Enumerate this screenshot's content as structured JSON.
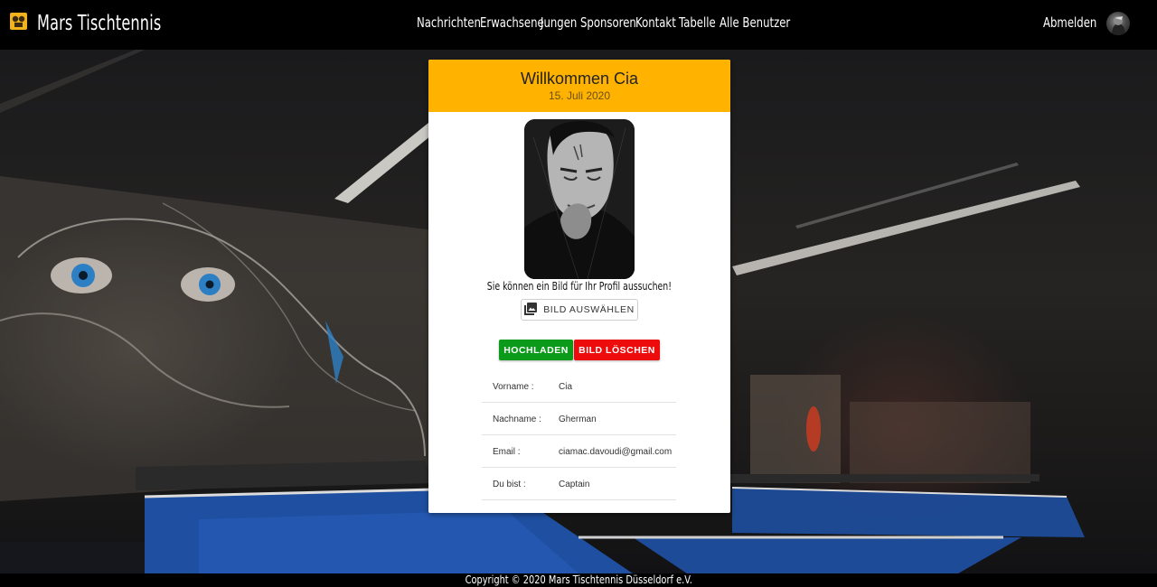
{
  "brand": {
    "title": "Mars Tischtennis",
    "logo_icon": "ping-pong-logo-icon"
  },
  "nav": {
    "items": [
      "Nachrichten",
      "Erwachsene",
      "Jungen",
      "Sponsoren",
      "Kontakt",
      "Tabelle",
      "Alle Benutzer"
    ],
    "logout": "Abmelden",
    "avatar_icon": "user-avatar"
  },
  "card": {
    "welcome": "Willkommen Cia",
    "date": "15. Juli 2020",
    "hint": "Sie können ein Bild für Ihr Profil aussuchen!",
    "choose_button": "BILD AUSWÄHLEN",
    "choose_icon": "image-icon",
    "upload_button": "HOCHLADEN",
    "delete_button": "BILD LÖSCHEN",
    "rows": [
      {
        "label": "Vorname :",
        "value": "Cia"
      },
      {
        "label": "Nachname :",
        "value": "Gherman"
      },
      {
        "label": "Email :",
        "value": "ciamac.davoudi@gmail.com"
      },
      {
        "label": "Du bist :",
        "value": "Captain"
      }
    ]
  },
  "footer": {
    "text": "Copyright © 2020  Mars Tischtennis Düsseldorf e.V."
  },
  "colors": {
    "header_bg": "#ffb300",
    "upload": "#0b9a1a",
    "delete": "#ee0b0b",
    "navbar": "#000000"
  }
}
